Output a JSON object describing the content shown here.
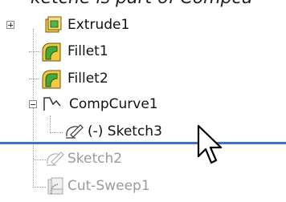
{
  "header_fragment": "ketche is part of Compcu",
  "tree": {
    "items": [
      {
        "label": "Extrude1",
        "icon": "extrude-icon",
        "expander": "plus"
      },
      {
        "label": "Fillet1",
        "icon": "fillet-icon"
      },
      {
        "label": "Fillet2",
        "icon": "fillet-icon"
      },
      {
        "label": "CompCurve1",
        "icon": "composite-curve-icon",
        "expander": "minus"
      },
      {
        "label": "(-) Sketch3",
        "icon": "sketch-icon"
      },
      {
        "label": "Sketch2",
        "icon": "sketch-icon",
        "rolled_back": true
      },
      {
        "label": "Cut-Sweep1",
        "icon": "cut-sweep-icon",
        "rolled_back": true
      }
    ]
  },
  "rollback_bar": {
    "color": "#3d70c4"
  }
}
